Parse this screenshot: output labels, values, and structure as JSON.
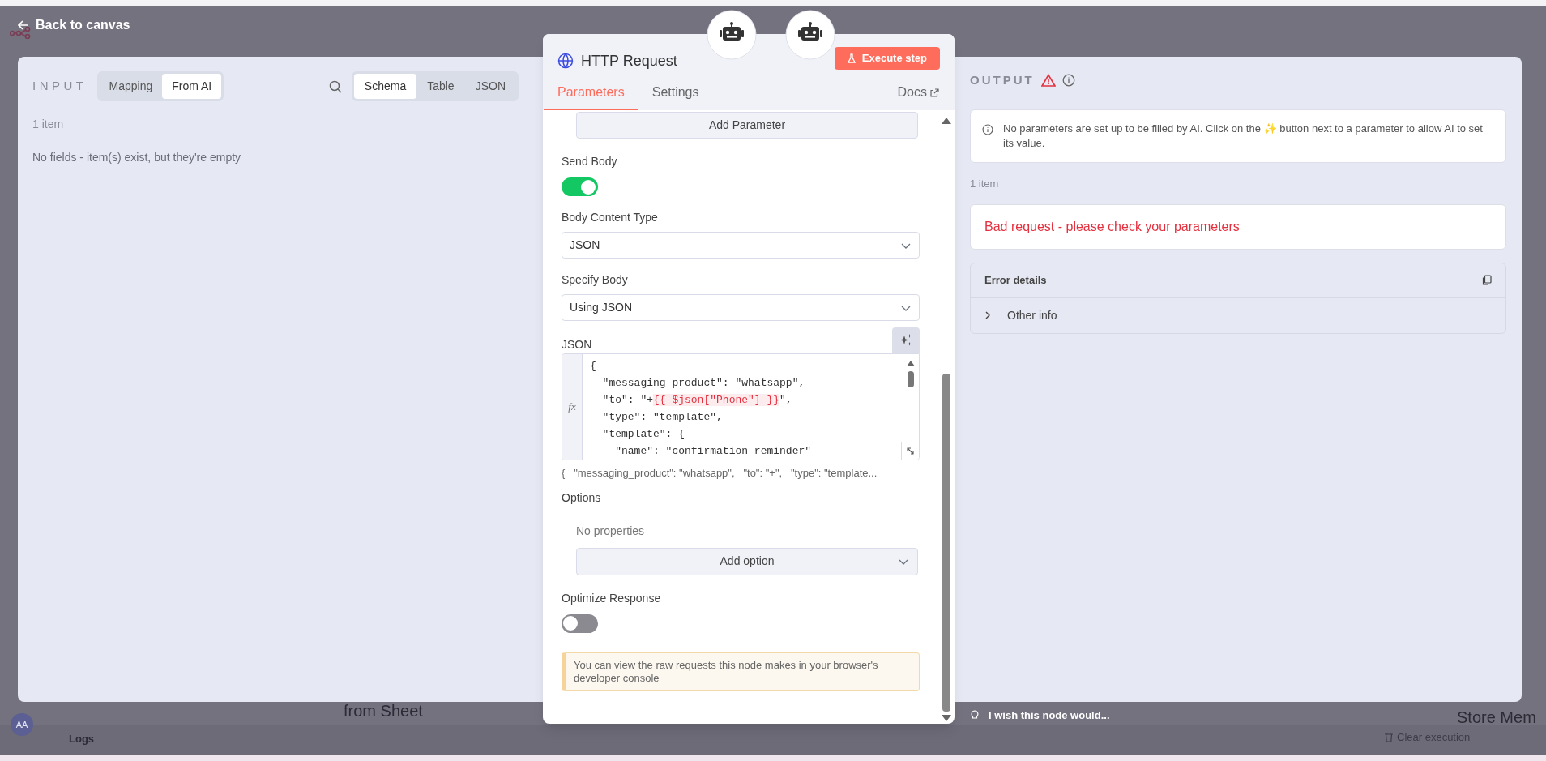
{
  "back_link": "Back to canvas",
  "canvas": {
    "fragments": [
      "from Sheet",
      "Store Mem"
    ],
    "avatar": "AA",
    "logs_label": "Logs",
    "clear_button": "Clear execution"
  },
  "input": {
    "title": "INPUT",
    "mode_tabs": [
      {
        "label": "Mapping",
        "selected": false
      },
      {
        "label": "From AI",
        "selected": true
      }
    ],
    "view_tabs": [
      {
        "label": "Schema",
        "selected": true
      },
      {
        "label": "Table",
        "selected": false
      },
      {
        "label": "JSON",
        "selected": false
      }
    ],
    "item_count": "1 item",
    "message": "No fields - item(s) exist, but they're empty"
  },
  "node": {
    "title": "HTTP Request",
    "execute_button": "Execute step",
    "tabs": [
      {
        "label": "Parameters",
        "selected": true
      },
      {
        "label": "Settings",
        "selected": false
      }
    ],
    "docs_link": "Docs",
    "add_parameter_button": "Add Parameter",
    "fields": [
      {
        "kind": "toggle",
        "label": "Send Body",
        "on": true
      },
      {
        "kind": "select",
        "label": "Body Content Type",
        "value": "JSON"
      },
      {
        "kind": "select",
        "label": "Specify Body",
        "value": "Using JSON"
      },
      {
        "kind": "code",
        "label": "JSON",
        "gutter_label": "fx",
        "lines": [
          [
            {
              "text": "{",
              "expr": false
            }
          ],
          [
            {
              "text": "  \"messaging_product\": \"whatsapp\",",
              "expr": false
            }
          ],
          [
            {
              "text": "  \"to\": \"+",
              "expr": false
            },
            {
              "text": "{{ $json[\"Phone\"] }}",
              "expr": true
            },
            {
              "text": "\",",
              "expr": false
            }
          ],
          [
            {
              "text": "  \"type\": \"template\",",
              "expr": false
            }
          ],
          [
            {
              "text": "  \"template\": {",
              "expr": false
            }
          ],
          [
            {
              "text": "    \"name\": \"confirmation_reminder\"",
              "expr": false
            }
          ]
        ],
        "preview": "{   \"messaging_product\": \"whatsapp\",   \"to\": \"+\",   \"type\": \"template..."
      },
      {
        "kind": "collection",
        "label": "Options",
        "empty_text": "No properties",
        "button": "Add option"
      },
      {
        "kind": "toggle",
        "label": "Optimize Response",
        "on": false
      },
      {
        "kind": "notice",
        "text": "You can view the raw requests this node makes in your browser's developer console"
      }
    ]
  },
  "output": {
    "title": "OUTPUT",
    "ai_hint": "No parameters are set up to be filled by AI. Click on the ✨ button next to a parameter to allow AI to set its value.",
    "item_count": "1 item",
    "error": "Bad request - please check your parameters",
    "error_details": {
      "title": "Error details",
      "rows": [
        {
          "label": "Other info",
          "expanded": false
        }
      ]
    }
  },
  "feedback": "I wish this node would..."
}
